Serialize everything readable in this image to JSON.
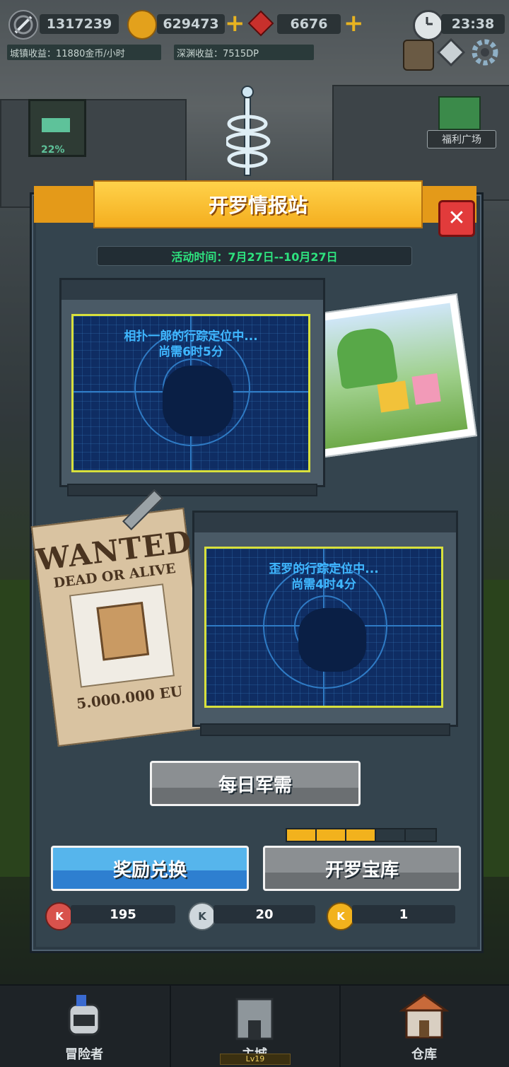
{
  "hud": {
    "sword_value": "1317239",
    "gold_value": "629473",
    "gem_value": "6676",
    "clock": "23:38",
    "town_income": "城镇收益：11880金币/小时",
    "abyss_income": "深渊收益：7515DP",
    "progress_badge": "22%",
    "welfare_label": "福利广场"
  },
  "panel": {
    "title": "开罗情报站",
    "event_time": "活动时间：7月27日--10月27日",
    "monitor1": {
      "line1": "相扑一郎的行踪定位中...",
      "line2": "尚需6时5分"
    },
    "monitor2": {
      "line1": "歪罗的行踪定位中...",
      "line2": "尚需4时4分"
    },
    "wanted": {
      "title": "WANTED",
      "subtitle": "DEAD OR ALIVE",
      "price": "5.000.000 EU"
    },
    "daily_button": "每日军需",
    "reward_button": "奖励兑换",
    "vault_button": "开罗宝库",
    "vault_progress": 0.6,
    "currencies": [
      {
        "name": "red-k-coin",
        "value": "195",
        "color": "#d8524c"
      },
      {
        "name": "silver-k-coin",
        "value": "20",
        "color": "#cfd7dc"
      },
      {
        "name": "gold-k-coin",
        "value": "1",
        "color": "#f2b21d"
      }
    ],
    "coin_letter": "K"
  },
  "nav": {
    "adventurer": "冒险者",
    "main_city": "主城",
    "main_city_level": "Lv19",
    "warehouse": "仓库"
  },
  "colors": {
    "accent_orange": "#f4ae1f",
    "timer_green": "#2ee37f",
    "screen_text": "#3fb7ff",
    "close_red": "#e23b3b"
  }
}
